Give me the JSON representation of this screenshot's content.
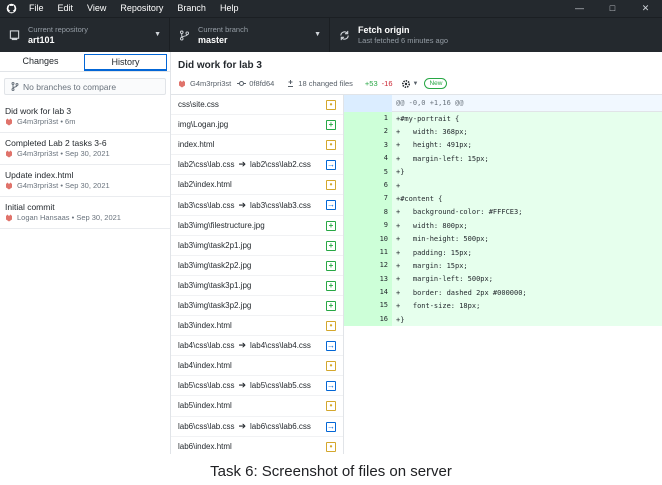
{
  "menu": {
    "items": [
      "File",
      "Edit",
      "View",
      "Repository",
      "Branch",
      "Help"
    ],
    "window_controls": [
      "—",
      "□",
      "✕"
    ]
  },
  "toolbar": {
    "repo_sub": "Current repository",
    "repo_name": "art101",
    "branch_sub": "Current branch",
    "branch_name": "master",
    "fetch_title": "Fetch origin",
    "fetch_sub": "Last fetched 6 minutes ago"
  },
  "sidebar": {
    "tabs": [
      "Changes",
      "History"
    ],
    "active_tab": "History",
    "compare_placeholder": "No branches to compare",
    "commits": [
      {
        "title": "Did work for lab 3",
        "meta": "G4m3rpri3st • 6m"
      },
      {
        "title": "Completed Lab 2 tasks 3-6",
        "meta": "G4m3rpri3st • Sep 30, 2021"
      },
      {
        "title": "Update index.html",
        "meta": "G4m3rpri3st • Sep 30, 2021"
      },
      {
        "title": "Initial commit",
        "meta": "Logan Hansaas • Sep 30, 2021"
      }
    ]
  },
  "commit": {
    "title": "Did work for lab 3",
    "author": "G4m3rpri3st",
    "sha": "0f8fd64",
    "changed": "18 changed files",
    "additions": "+53",
    "deletions": "-16",
    "badge": "New"
  },
  "files": [
    {
      "from": "css\\site.css",
      "to": "",
      "status": "modified",
      "symbol": "•"
    },
    {
      "from": "img\\Logan.jpg",
      "to": "",
      "status": "added",
      "symbol": "+"
    },
    {
      "from": "index.html",
      "to": "",
      "status": "modified",
      "symbol": "•"
    },
    {
      "from": "lab2\\css\\lab.css",
      "to": "lab2\\css\\lab2.css",
      "status": "renamed",
      "symbol": "→"
    },
    {
      "from": "lab2\\index.html",
      "to": "",
      "status": "modified",
      "symbol": "•"
    },
    {
      "from": "lab3\\css\\lab.css",
      "to": "lab3\\css\\lab3.css",
      "status": "renamed",
      "symbol": "→"
    },
    {
      "from": "lab3\\img\\filestructure.jpg",
      "to": "",
      "status": "added",
      "symbol": "+"
    },
    {
      "from": "lab3\\img\\task2p1.jpg",
      "to": "",
      "status": "added",
      "symbol": "+"
    },
    {
      "from": "lab3\\img\\task2p2.jpg",
      "to": "",
      "status": "added",
      "symbol": "+"
    },
    {
      "from": "lab3\\img\\task3p1.jpg",
      "to": "",
      "status": "added",
      "symbol": "+"
    },
    {
      "from": "lab3\\img\\task3p2.jpg",
      "to": "",
      "status": "added",
      "symbol": "+"
    },
    {
      "from": "lab3\\index.html",
      "to": "",
      "status": "modified",
      "symbol": "•"
    },
    {
      "from": "lab4\\css\\lab.css",
      "to": "lab4\\css\\lab4.css",
      "status": "renamed",
      "symbol": "→"
    },
    {
      "from": "lab4\\index.html",
      "to": "",
      "status": "modified",
      "symbol": "•"
    },
    {
      "from": "lab5\\css\\lab.css",
      "to": "lab5\\css\\lab5.css",
      "status": "renamed",
      "symbol": "→"
    },
    {
      "from": "lab5\\index.html",
      "to": "",
      "status": "modified",
      "symbol": "•"
    },
    {
      "from": "lab6\\css\\lab.css",
      "to": "lab6\\css\\lab6.css",
      "status": "renamed",
      "symbol": "→"
    },
    {
      "from": "lab6\\index.html",
      "to": "",
      "status": "modified",
      "symbol": "•"
    }
  ],
  "diff": {
    "hunk": "@@ -0,0 +1,16 @@",
    "lines": [
      {
        "num": "1",
        "text": "+#my-portrait {"
      },
      {
        "num": "2",
        "text": "+   width: 368px;"
      },
      {
        "num": "3",
        "text": "+   height: 491px;"
      },
      {
        "num": "4",
        "text": "+   margin-left: 15px;"
      },
      {
        "num": "5",
        "text": "+}"
      },
      {
        "num": "6",
        "text": "+"
      },
      {
        "num": "7",
        "text": "+#content {"
      },
      {
        "num": "8",
        "text": "+   background-color: #FFFCE3;"
      },
      {
        "num": "9",
        "text": "+   width: 800px;"
      },
      {
        "num": "10",
        "text": "+   min-height: 500px;"
      },
      {
        "num": "11",
        "text": "+   padding: 15px;"
      },
      {
        "num": "12",
        "text": "+   margin: 15px;"
      },
      {
        "num": "13",
        "text": "+   margin-left: 500px;"
      },
      {
        "num": "14",
        "text": "+   border: dashed 2px #000000;"
      },
      {
        "num": "15",
        "text": "+   font-size: 18px;"
      },
      {
        "num": "16",
        "text": "+}"
      }
    ]
  },
  "caption": "Task 6: Screenshot of files on server",
  "colors": {
    "titlebar": "#24292e",
    "added_bg": "#e6ffed",
    "added_gutter": "#cdffd8",
    "accent": "#0366d6"
  }
}
